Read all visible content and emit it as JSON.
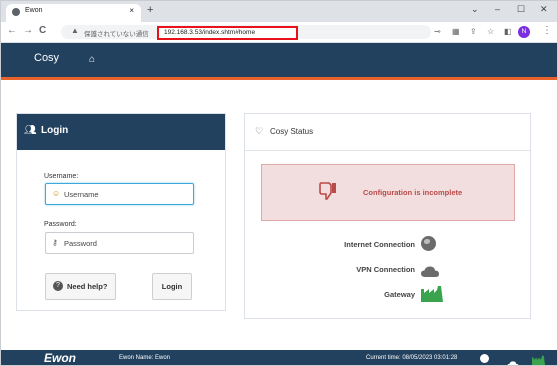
{
  "browser": {
    "tab_title": "Ewon",
    "tab_close": "×",
    "new_tab": "+",
    "window_controls": [
      "⌄",
      "–",
      "☐",
      "✕"
    ],
    "nav": {
      "back": "←",
      "forward": "→",
      "reload": "C"
    },
    "security_warning": "保護されていない通信",
    "url": "192.168.3.53/index.shtm#home",
    "toolbar_icons": [
      "key-icon",
      "translate-icon",
      "share-icon",
      "star-icon",
      "sidepanel-icon"
    ],
    "profile_initial": "N",
    "menu": "⋮"
  },
  "navbar": {
    "brand": "Cosy",
    "home_icon": "home-icon"
  },
  "login": {
    "title": "Login",
    "username_label": "Username:",
    "username_placeholder": "Username",
    "password_label": "Password:",
    "password_placeholder": "Password",
    "help_label": "Need help?",
    "login_label": "Login"
  },
  "status": {
    "title": "Cosy Status",
    "alert_text": "Configuration is incomplete",
    "internet_label": "Internet Connection",
    "vpn_label": "VPN Connection",
    "gateway_label": "Gateway",
    "colors": {
      "neutral": "#6b6b6b",
      "ok": "#3aa34d",
      "alert": "#b94a48"
    }
  },
  "footer": {
    "logo": "Ewon",
    "name": "Ewon Name: Ewon",
    "time": "Current time: 08/05/2023 03:01:28"
  }
}
